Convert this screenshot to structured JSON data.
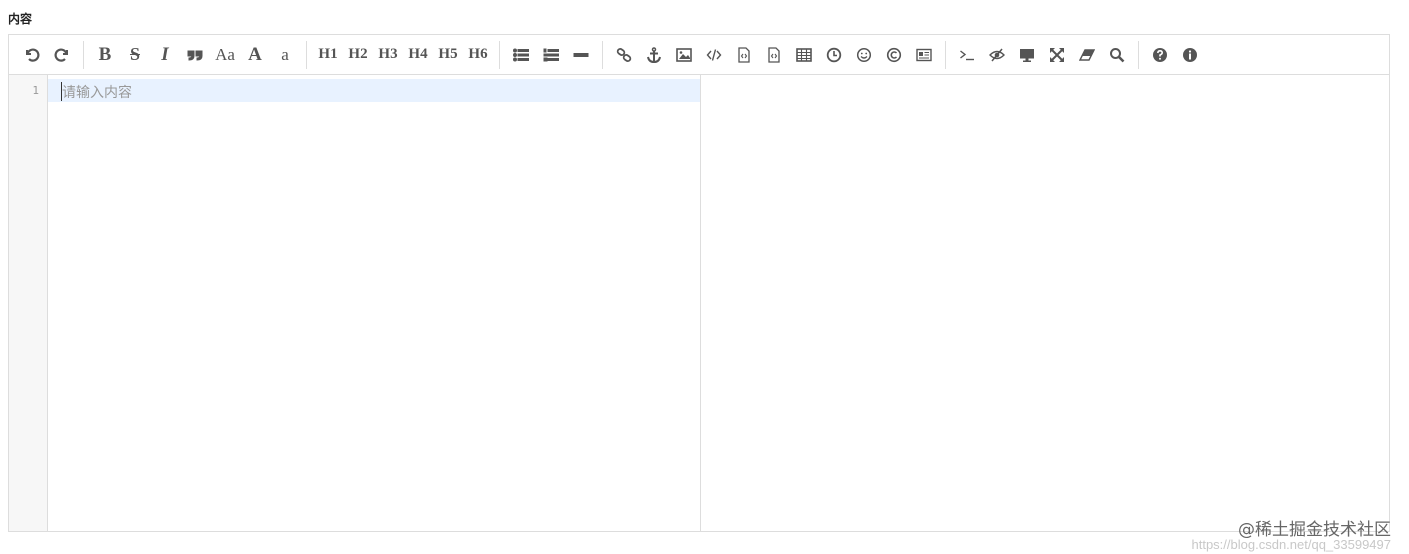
{
  "field": {
    "label": "内容"
  },
  "toolbar": {
    "groups": [
      [
        "undo-icon",
        "redo-icon"
      ],
      [
        "bold",
        "strikethrough",
        "italic",
        "quote",
        "case",
        "uppercase",
        "lowercase"
      ],
      [
        "h1",
        "h2",
        "h3",
        "h4",
        "h5",
        "h6"
      ],
      [
        "list-ul",
        "list-ol",
        "hr"
      ],
      [
        "link",
        "anchor",
        "image",
        "code",
        "preformatted",
        "code-block",
        "table",
        "datetime",
        "emoji",
        "html-entities",
        "pagebreak"
      ],
      [
        "goto-line",
        "watch",
        "preview",
        "fullscreen",
        "clear",
        "search"
      ],
      [
        "help",
        "info"
      ]
    ],
    "labels": {
      "bold": "B",
      "strike": "S",
      "italic": "I",
      "case": "Aa",
      "upper": "A",
      "lower": "a",
      "h1": "H1",
      "h2": "H2",
      "h3": "H3",
      "h4": "H4",
      "h5": "H5",
      "h6": "H6"
    }
  },
  "editor": {
    "line_number": "1",
    "placeholder": "请输入内容"
  },
  "watermark": {
    "text": "@稀土掘金技术社区",
    "url": "https://blog.csdn.net/qq_33599497"
  },
  "colors": {
    "active_line": "#e8f2ff",
    "border": "#dddddd",
    "icon": "#555555"
  }
}
